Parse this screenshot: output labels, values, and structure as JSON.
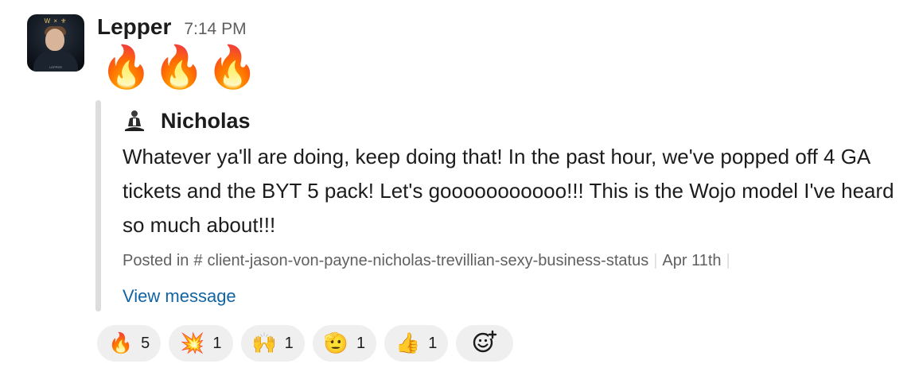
{
  "message": {
    "sender": "Lepper",
    "time": "7:14 PM",
    "content_emoji": "🔥🔥🔥",
    "avatar_icon": "profile-photo",
    "avatar_logo": "W × ",
    "avatar_caption": "LEPPER"
  },
  "quote": {
    "author": "Nicholas",
    "author_icon": "meditating-person-icon",
    "text": "Whatever ya'll are doing, keep doing that! In the past hour, we've popped off 4 GA tickets and the BYT 5 pack! Let's gooooooooooo!!! This is the Wojo model I've heard so much about!!!",
    "posted_in_label": "Posted in",
    "channel_hash": "#",
    "channel": "client-jason-von-payne-nicholas-trevillian-sexy-business-status",
    "date": "Apr 11th",
    "view_link": "View message"
  },
  "reactions": [
    {
      "emoji": "🔥",
      "count": "5",
      "icon": "fire-icon"
    },
    {
      "emoji": "💥",
      "count": "1",
      "icon": "collision-icon"
    },
    {
      "emoji": "🙌",
      "count": "1",
      "icon": "raised-hands-icon"
    },
    {
      "emoji": "🫡",
      "count": "1",
      "icon": "saluting-face-icon"
    },
    {
      "emoji": "👍",
      "count": "1",
      "icon": "thumbs-up-icon"
    }
  ],
  "add_reaction_icon": "add-reaction-icon",
  "colors": {
    "text": "#1d1c1d",
    "muted": "#616061",
    "link": "#1264a3",
    "reaction_bg": "#efefef",
    "quote_bar": "#dddddd"
  }
}
